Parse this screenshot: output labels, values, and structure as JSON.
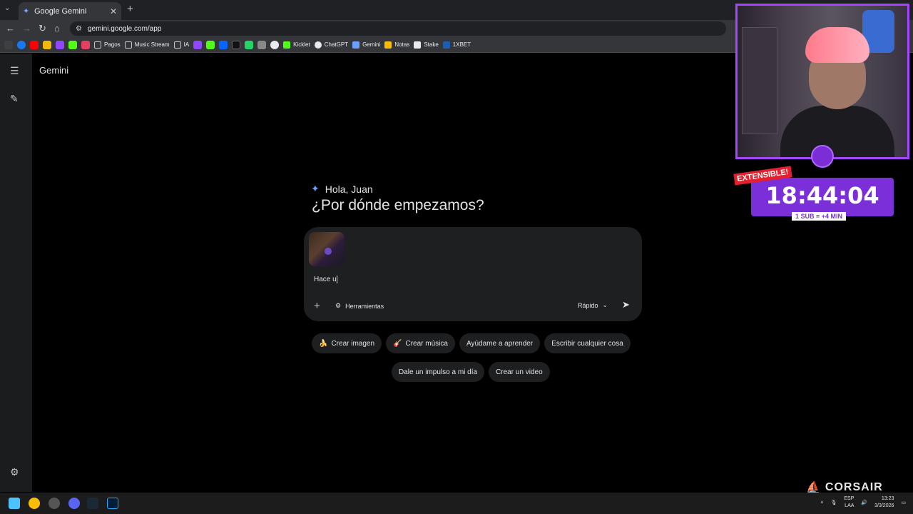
{
  "browser": {
    "tab_title": "Google Gemini",
    "url": "gemini.google.com/app",
    "bookmarks": [
      "Pagos",
      "Music Stream",
      "IA",
      "Kicklet",
      "ChatGPT",
      "Gemini",
      "Notas",
      "Stake",
      "1XBET"
    ]
  },
  "app": {
    "brand": "Gemini",
    "greeting": "Hola, Juan",
    "headline": "¿Por dónde empezamos?",
    "prompt_text": "Hace u",
    "tools_label": "Herramientas",
    "mode_label": "Rápido"
  },
  "suggestions": {
    "row1": [
      {
        "emoji": "🍌",
        "label": "Crear imagen"
      },
      {
        "emoji": "🎸",
        "label": "Crear música"
      },
      {
        "emoji": "",
        "label": "Ayúdame a aprender"
      },
      {
        "emoji": "",
        "label": "Escribir cualquier cosa"
      }
    ],
    "row2": [
      {
        "emoji": "",
        "label": "Dale un impulso a mi día"
      },
      {
        "emoji": "",
        "label": "Crear un video"
      }
    ]
  },
  "overlay": {
    "extensible": "EXTENSIBLE!",
    "timer": "18:44:04",
    "sub_rule": "1 SUB = +4 MIN",
    "sponsor": "CORSAIR"
  },
  "taskbar": {
    "lang_top": "ESP",
    "lang_bottom": "LAA",
    "time": "13:23",
    "date": "3/3/2026"
  },
  "colors": {
    "accent": "#a545ff",
    "timer_bg": "#7b2fd9",
    "composer_bg": "#1e1f20"
  }
}
